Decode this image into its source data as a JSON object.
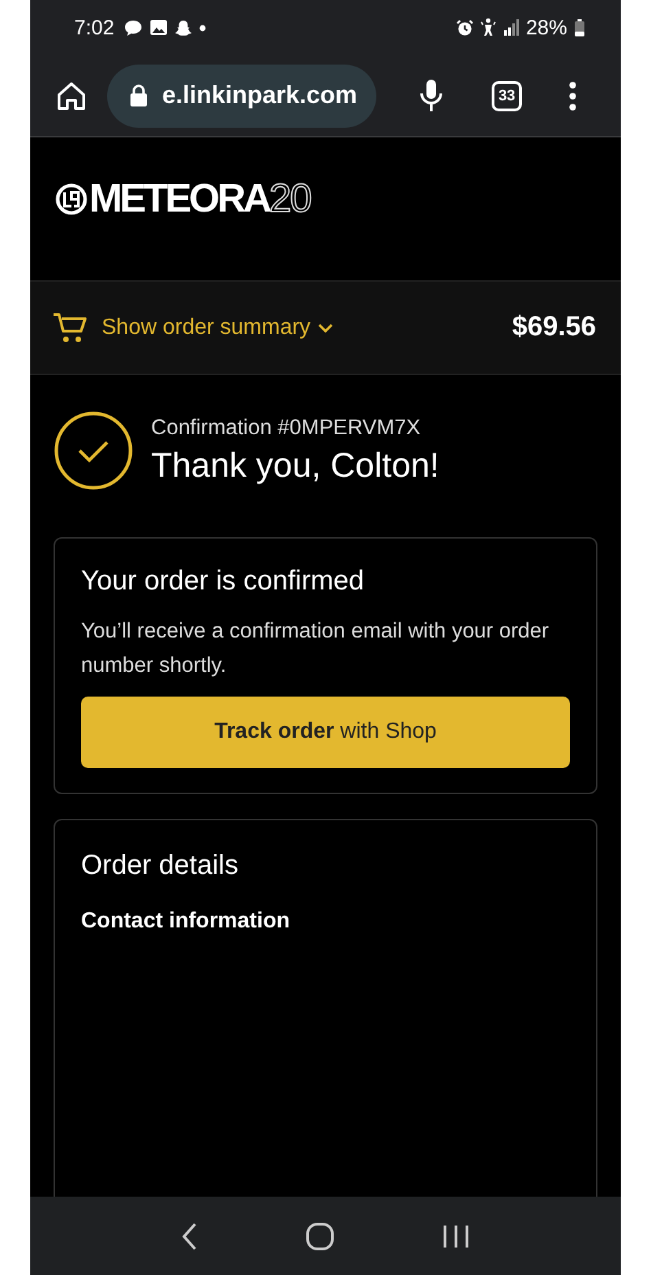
{
  "status_bar": {
    "time": "7:02",
    "battery": "28%"
  },
  "browser": {
    "url": "e.linkinpark.com",
    "tab_count": "33"
  },
  "logo": {
    "wordmark": "METEORA",
    "suffix": "20"
  },
  "order_summary": {
    "label": "Show order summary",
    "expanded": false,
    "total": "$69.56"
  },
  "confirmation": {
    "number": "Confirmation #0MPERVM7X",
    "heading": "Thank you, Colton!"
  },
  "confirmed_card": {
    "title": "Your order is confirmed",
    "body": "You’ll receive a confirmation email with your order number shortly.",
    "button": "**Track order** with Shop"
  },
  "order_details": {
    "title": "Order details",
    "sections": [
      {
        "heading": "Contact information"
      }
    ]
  }
}
